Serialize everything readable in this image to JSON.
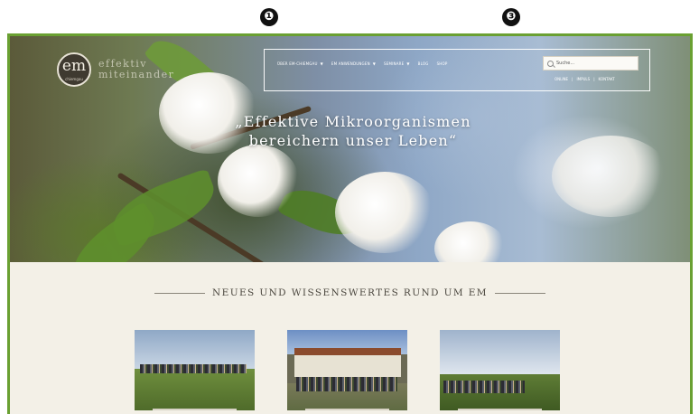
{
  "annotations": {
    "marker_1": "❶",
    "marker_3": "❸"
  },
  "site": {
    "logo_mark": "em",
    "logo_sub": "chiemgau",
    "logo_line1": "effektiv",
    "logo_line2": "miteinander"
  },
  "nav": {
    "items": [
      {
        "label": "ÜBER EM-CHIEMGAU",
        "has_dropdown": true
      },
      {
        "label": "EM ANWENDUNGEN",
        "has_dropdown": true
      },
      {
        "label": "SEMINARE",
        "has_dropdown": true
      },
      {
        "label": "BLOG",
        "has_dropdown": false
      },
      {
        "label": "SHOP",
        "has_dropdown": false
      }
    ],
    "search_placeholder": "Suche...",
    "util_links": [
      "ONLINE",
      "IMPULS",
      "KONTAKT"
    ]
  },
  "hero": {
    "title_line1": "„Effektive Mikroorganismen",
    "title_line2": "bereichern unser Leben“"
  },
  "news": {
    "heading": "NEUES UND WISSENSWERTES RUND UM EM"
  },
  "colors": {
    "frame_border": "#6aa032",
    "section_background": "#f3f0e7"
  }
}
